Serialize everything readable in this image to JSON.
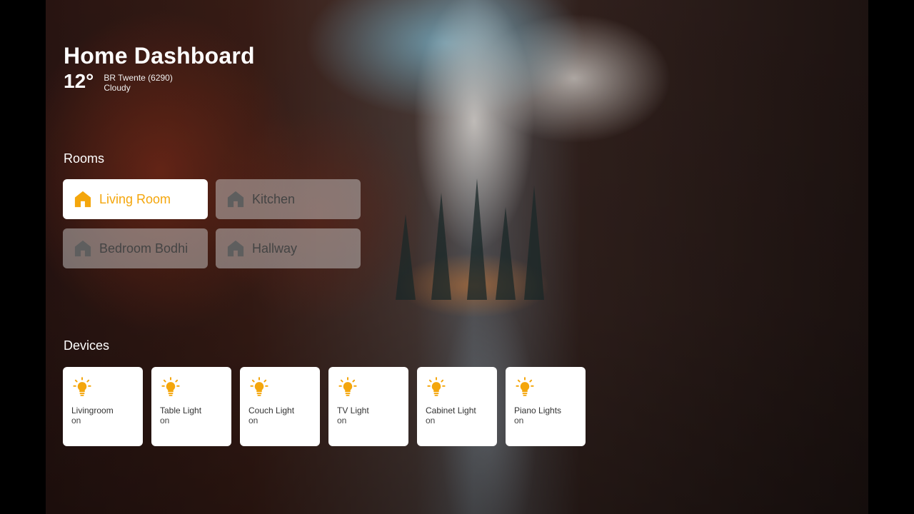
{
  "header": {
    "title": "Home Dashboard"
  },
  "weather": {
    "temperature": "12°",
    "station": "BR Twente (6290)",
    "condition": "Cloudy"
  },
  "rooms": {
    "title": "Rooms",
    "items": [
      {
        "label": "Living Room",
        "active": true,
        "icon": "home-icon"
      },
      {
        "label": "Kitchen",
        "active": false,
        "icon": "home-icon"
      },
      {
        "label": "Bedroom Bodhi",
        "active": false,
        "icon": "home-icon"
      },
      {
        "label": "Hallway",
        "active": false,
        "icon": "home-icon"
      }
    ]
  },
  "devices": {
    "title": "Devices",
    "items": [
      {
        "name": "Livingroom",
        "state": "on",
        "icon": "lightbulb-icon"
      },
      {
        "name": "Table Light",
        "state": "on",
        "icon": "lightbulb-icon"
      },
      {
        "name": "Couch Light",
        "state": "on",
        "icon": "lightbulb-icon"
      },
      {
        "name": "TV Light",
        "state": "on",
        "icon": "lightbulb-icon"
      },
      {
        "name": "Cabinet Light",
        "state": "on",
        "icon": "lightbulb-icon"
      },
      {
        "name": "Piano Lights",
        "state": "on",
        "icon": "lightbulb-icon"
      }
    ]
  },
  "colors": {
    "accent": "#f4a60c",
    "inactive_icon": "#666666",
    "card_background": "#ffffff"
  }
}
